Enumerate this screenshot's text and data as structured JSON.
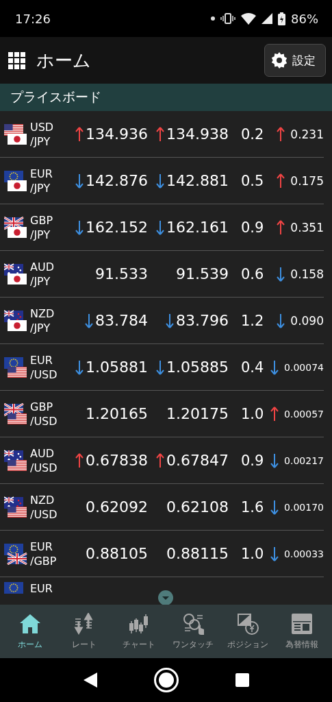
{
  "status_bar": {
    "time": "17:26",
    "battery": "86%"
  },
  "header": {
    "title": "ホーム",
    "settings_button": "設定"
  },
  "section": {
    "title": "プライスボード"
  },
  "rows": [
    {
      "base": "USD",
      "quote": "/JPY",
      "bid_up": true,
      "bid_down": false,
      "bid": "134.936",
      "ask_up": true,
      "ask_down": false,
      "ask": "134.938",
      "spread": "0.2",
      "change_up": true,
      "change_down": false,
      "change": "0.231"
    },
    {
      "base": "EUR",
      "quote": "/JPY",
      "bid_up": false,
      "bid_down": true,
      "bid": "142.876",
      "ask_up": false,
      "ask_down": true,
      "ask": "142.881",
      "spread": "0.5",
      "change_up": true,
      "change_down": false,
      "change": "0.175"
    },
    {
      "base": "GBP",
      "quote": "/JPY",
      "bid_up": false,
      "bid_down": true,
      "bid": "162.152",
      "ask_up": false,
      "ask_down": true,
      "ask": "162.161",
      "spread": "0.9",
      "change_up": true,
      "change_down": false,
      "change": "0.351"
    },
    {
      "base": "AUD",
      "quote": "/JPY",
      "bid_up": false,
      "bid_down": false,
      "bid": "91.533",
      "ask_up": false,
      "ask_down": false,
      "ask": "91.539",
      "spread": "0.6",
      "change_up": false,
      "change_down": true,
      "change": "0.158"
    },
    {
      "base": "NZD",
      "quote": "/JPY",
      "bid_up": false,
      "bid_down": true,
      "bid": "83.784",
      "ask_up": false,
      "ask_down": true,
      "ask": "83.796",
      "spread": "1.2",
      "change_up": false,
      "change_down": true,
      "change": "0.090"
    },
    {
      "base": "EUR",
      "quote": "/USD",
      "bid_up": false,
      "bid_down": true,
      "bid": "1.05881",
      "ask_up": false,
      "ask_down": true,
      "ask": "1.05885",
      "spread": "0.4",
      "change_up": false,
      "change_down": true,
      "change": "0.00074"
    },
    {
      "base": "GBP",
      "quote": "/USD",
      "bid_up": false,
      "bid_down": false,
      "bid": "1.20165",
      "ask_up": false,
      "ask_down": false,
      "ask": "1.20175",
      "spread": "1.0",
      "change_up": true,
      "change_down": false,
      "change": "0.00057"
    },
    {
      "base": "AUD",
      "quote": "/USD",
      "bid_up": true,
      "bid_down": false,
      "bid": "0.67838",
      "ask_up": true,
      "ask_down": false,
      "ask": "0.67847",
      "spread": "0.9",
      "change_up": false,
      "change_down": true,
      "change": "0.00217"
    },
    {
      "base": "NZD",
      "quote": "/USD",
      "bid_up": false,
      "bid_down": false,
      "bid": "0.62092",
      "ask_up": false,
      "ask_down": false,
      "ask": "0.62108",
      "spread": "1.6",
      "change_up": false,
      "change_down": true,
      "change": "0.00170"
    },
    {
      "base": "EUR",
      "quote": "/GBP",
      "bid_up": false,
      "bid_down": false,
      "bid": "0.88105",
      "ask_up": false,
      "ask_down": false,
      "ask": "0.88115",
      "spread": "1.0",
      "change_up": false,
      "change_down": true,
      "change": "0.00033"
    },
    {
      "base": "EUR"
    }
  ],
  "bottom_nav": [
    {
      "label": "ホーム",
      "selected": true
    },
    {
      "label": "レート",
      "selected": false
    },
    {
      "label": "チャート",
      "selected": false
    },
    {
      "label": "ワンタッチ",
      "selected": false
    },
    {
      "label": "ポジション",
      "selected": false
    },
    {
      "label": "為替情報",
      "selected": false
    }
  ]
}
